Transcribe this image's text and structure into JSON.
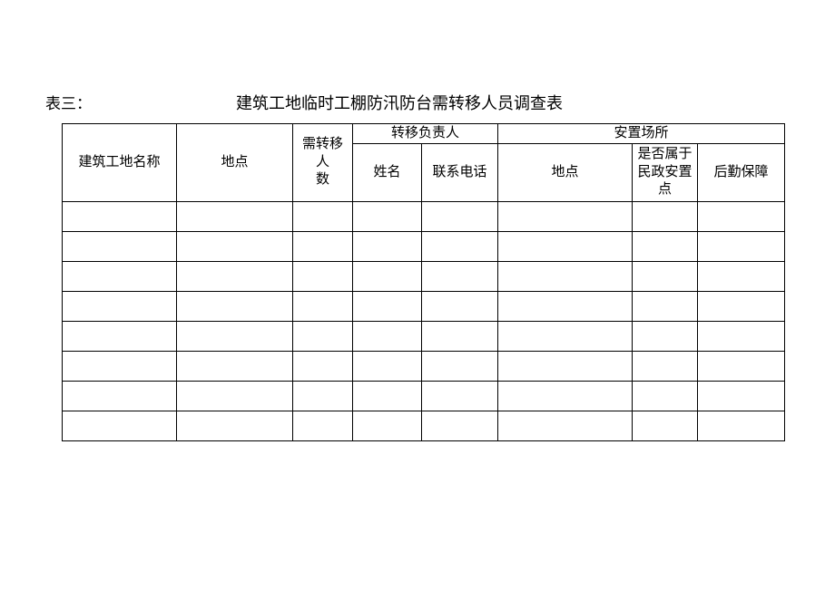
{
  "heading": {
    "label": "表三：",
    "title": "建筑工地临时工棚防汛防台需转移人员调查表"
  },
  "columns": {
    "site_name": "建筑工地名称",
    "location": "地点",
    "people_count": "需转移人\n数",
    "transfer_group": "转移负责人",
    "transfer_name": "姓名",
    "transfer_phone": "联系电话",
    "settle_group": "安置场所",
    "settle_location": "地点",
    "settle_civil": "是否属于\n民政安置\n点",
    "settle_logistics": "后勤保障"
  },
  "rows": [
    {
      "site_name": "",
      "location": "",
      "people_count": "",
      "transfer_name": "",
      "transfer_phone": "",
      "settle_location": "",
      "settle_civil": "",
      "settle_logistics": ""
    },
    {
      "site_name": "",
      "location": "",
      "people_count": "",
      "transfer_name": "",
      "transfer_phone": "",
      "settle_location": "",
      "settle_civil": "",
      "settle_logistics": ""
    },
    {
      "site_name": "",
      "location": "",
      "people_count": "",
      "transfer_name": "",
      "transfer_phone": "",
      "settle_location": "",
      "settle_civil": "",
      "settle_logistics": ""
    },
    {
      "site_name": "",
      "location": "",
      "people_count": "",
      "transfer_name": "",
      "transfer_phone": "",
      "settle_location": "",
      "settle_civil": "",
      "settle_logistics": ""
    },
    {
      "site_name": "",
      "location": "",
      "people_count": "",
      "transfer_name": "",
      "transfer_phone": "",
      "settle_location": "",
      "settle_civil": "",
      "settle_logistics": ""
    },
    {
      "site_name": "",
      "location": "",
      "people_count": "",
      "transfer_name": "",
      "transfer_phone": "",
      "settle_location": "",
      "settle_civil": "",
      "settle_logistics": ""
    },
    {
      "site_name": "",
      "location": "",
      "people_count": "",
      "transfer_name": "",
      "transfer_phone": "",
      "settle_location": "",
      "settle_civil": "",
      "settle_logistics": ""
    },
    {
      "site_name": "",
      "location": "",
      "people_count": "",
      "transfer_name": "",
      "transfer_phone": "",
      "settle_location": "",
      "settle_civil": "",
      "settle_logistics": ""
    }
  ]
}
